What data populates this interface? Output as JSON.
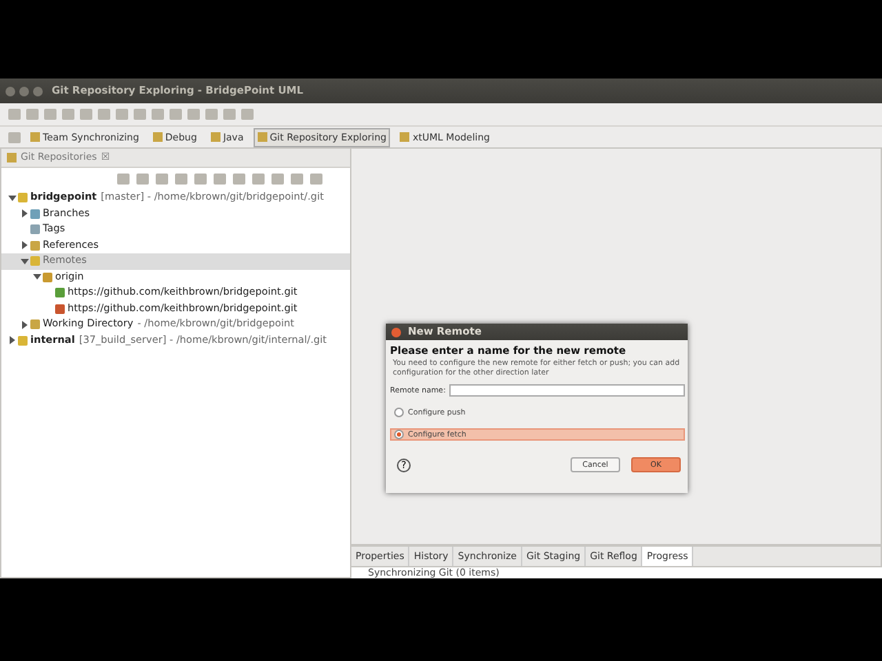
{
  "window": {
    "title": "Git Repository Exploring - BridgePoint UML"
  },
  "perspectives": [
    {
      "label": "Team Synchronizing",
      "selected": false
    },
    {
      "label": "Debug",
      "selected": false
    },
    {
      "label": "Java",
      "selected": false
    },
    {
      "label": "Git Repository Exploring",
      "selected": true
    },
    {
      "label": "xtUML Modeling",
      "selected": false
    }
  ],
  "left_view": {
    "title": "Git Repositories",
    "close": "☒"
  },
  "tree": [
    {
      "label": "bridgepoint",
      "detail": "[master] - /home/kbrown/git/bridgepoint/.git",
      "kind": "repo",
      "expanded": true,
      "selected": false,
      "children": [
        {
          "label": "Branches",
          "kind": "branches",
          "expanded": false,
          "selected": false
        },
        {
          "label": "Tags",
          "kind": "tags",
          "selected": false
        },
        {
          "label": "References",
          "kind": "folder",
          "expanded": false,
          "selected": false
        },
        {
          "label": "Remotes",
          "kind": "repo",
          "expanded": true,
          "selected": true,
          "children": [
            {
              "label": "origin",
              "kind": "remote",
              "expanded": true,
              "selected": false,
              "children": [
                {
                  "label": "https://github.com/keithbrown/bridgepoint.git",
                  "kind": "fetch",
                  "selected": false
                },
                {
                  "label": "https://github.com/keithbrown/bridgepoint.git",
                  "kind": "push",
                  "selected": false
                }
              ]
            }
          ]
        },
        {
          "label": "Working Directory",
          "detail": "- /home/kbrown/git/bridgepoint",
          "kind": "folder",
          "expanded": false,
          "selected": false
        }
      ]
    },
    {
      "label": "internal",
      "detail": "[37_build_server] - /home/kbrown/git/internal/.git",
      "kind": "repo",
      "expanded": false,
      "selected": false
    }
  ],
  "bottom_tabs": [
    {
      "label": "Properties",
      "selected": false
    },
    {
      "label": "History",
      "selected": false
    },
    {
      "label": "Synchronize",
      "selected": false
    },
    {
      "label": "Git Staging",
      "selected": false
    },
    {
      "label": "Git Reflog",
      "selected": false
    },
    {
      "label": "Progress",
      "selected": true
    }
  ],
  "bottom_status": "Synchronizing Git (0 items)",
  "dialog": {
    "title": "New Remote",
    "heading": "Please enter a name for the new remote",
    "message": "You need to configure the new remote for either fetch or push; you can add configuration for the other direction later",
    "field_label": "Remote name:",
    "options": [
      {
        "label": "Configure push",
        "selected": false
      },
      {
        "label": "Configure fetch",
        "selected": true
      }
    ],
    "help": "?",
    "buttons": [
      "Cancel",
      "OK"
    ]
  }
}
